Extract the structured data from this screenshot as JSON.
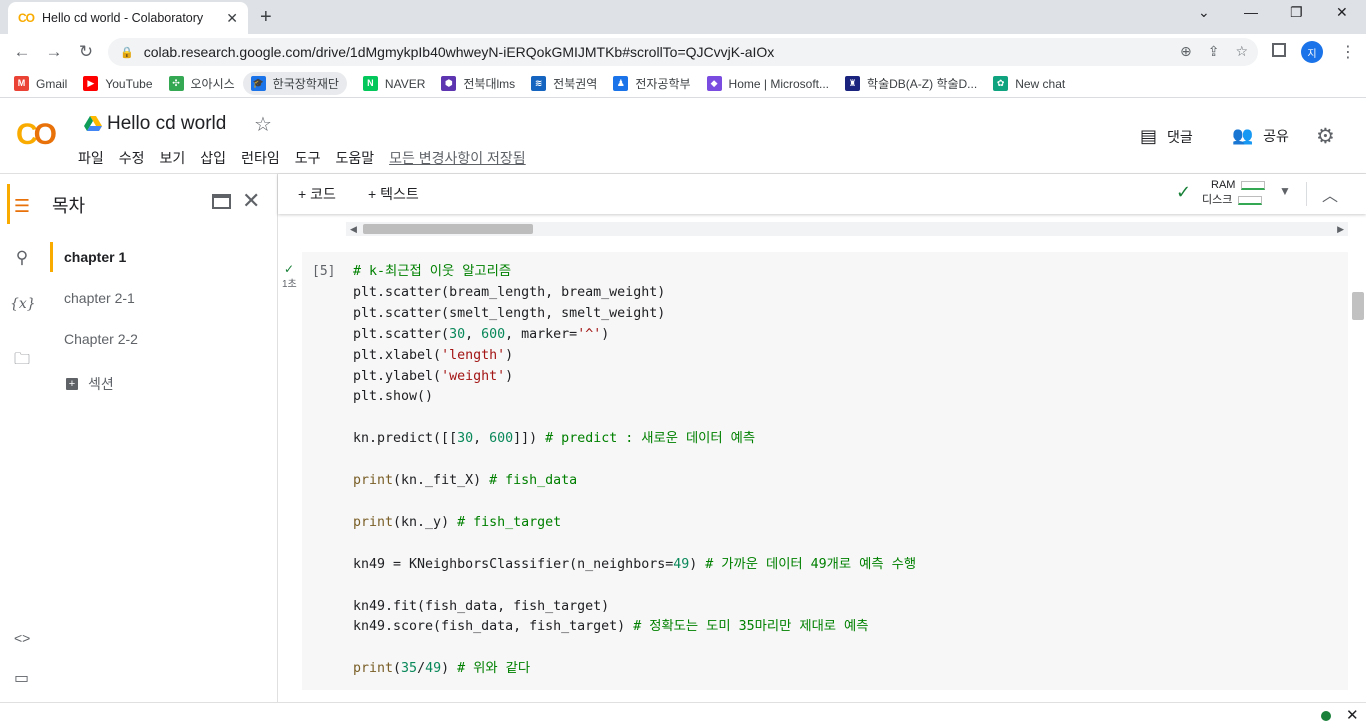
{
  "browser": {
    "tab_title": "Hello cd world - Colaboratory",
    "tab_logo": "CO",
    "url": "colab.research.google.com/drive/1dMgmykpIb40whweyN-iERQokGMIJMTKb#scrollTo=QJCvvjK-aIOx",
    "profile_initial": "지",
    "bookmarks": [
      {
        "label": "Gmail",
        "color": "#ea4335",
        "glyph": "M"
      },
      {
        "label": "YouTube",
        "color": "#ff0000",
        "glyph": "▶"
      },
      {
        "label": "오아시스",
        "color": "#34a853",
        "glyph": "✣"
      },
      {
        "label": "한국장학재단",
        "color": "#1a73e8",
        "glyph": "🎓"
      },
      {
        "label": "NAVER",
        "color": "#03c75a",
        "glyph": "N"
      },
      {
        "label": "전북대lms",
        "color": "#5e35b1",
        "glyph": "⬢"
      },
      {
        "label": "전북권역",
        "color": "#1565c0",
        "glyph": "≋"
      },
      {
        "label": "전자공학부",
        "color": "#1a73e8",
        "glyph": "♟"
      },
      {
        "label": "Home | Microsoft...",
        "color": "#7b4ce0",
        "glyph": "◆"
      },
      {
        "label": "학술DB(A-Z) 학술D...",
        "color": "#1a237e",
        "glyph": "♜"
      },
      {
        "label": "New chat",
        "color": "#10a37f",
        "glyph": "✿"
      }
    ]
  },
  "colab": {
    "notebook_title": "Hello cd world",
    "menu": [
      "파일",
      "수정",
      "보기",
      "삽입",
      "런타임",
      "도구",
      "도움말"
    ],
    "saved_status": "모든 변경사항이 저장됨",
    "comment_label": "댓글",
    "share_label": "공유",
    "toolbar": {
      "add_code": "+ 코드",
      "add_text": "+ 텍스트",
      "ram_label": "RAM",
      "disk_label": "디스크"
    },
    "toc": {
      "title": "목차",
      "items": [
        "chapter 1",
        "chapter 2-1",
        "Chapter 2-2"
      ],
      "add_section": "섹션"
    },
    "cell": {
      "exec_count": "[5]",
      "run_time": "1초"
    }
  }
}
